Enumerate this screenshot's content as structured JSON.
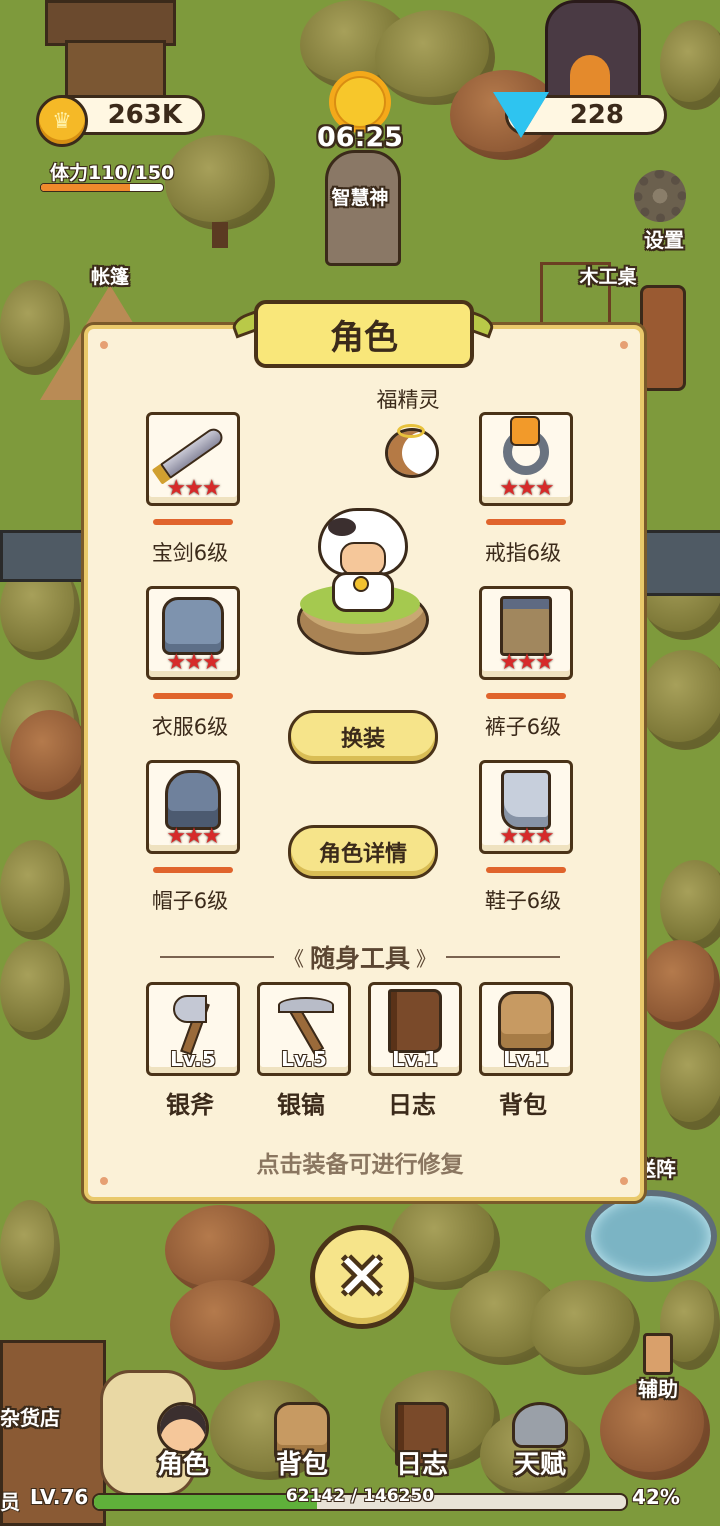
{
  "hud": {
    "coins": "263K",
    "gems": "228",
    "time": "06:25",
    "stamina_label": "体力110/150",
    "stamina_fraction": 0.733
  },
  "map_labels": {
    "god": "智慧神",
    "settings": "设置",
    "tent": "帐篷",
    "workbench": "木工桌",
    "portal": "送阵",
    "assist": "辅助",
    "store": "杂货店"
  },
  "modal": {
    "title": "角色",
    "pet_name": "福精灵",
    "equipment": [
      {
        "label": "宝剑6级",
        "icon": "sword-icon",
        "stars": "★★★"
      },
      {
        "label": "戒指6级",
        "icon": "ring-icon",
        "stars": "★★★"
      },
      {
        "label": "衣服6级",
        "icon": "armor-icon",
        "stars": "★★★"
      },
      {
        "label": "裤子6级",
        "icon": "pants-icon",
        "stars": "★★★"
      },
      {
        "label": "帽子6级",
        "icon": "helmet-icon",
        "stars": "★★★"
      },
      {
        "label": "鞋子6级",
        "icon": "boots-icon",
        "stars": "★★★"
      }
    ],
    "change_outfit": "换装",
    "character_details": "角色详情",
    "tools_header": "随身工具",
    "tools": [
      {
        "label": "银斧",
        "level": "Lv.5",
        "icon": "axe-icon"
      },
      {
        "label": "银镐",
        "level": "Lv.5",
        "icon": "pickaxe-icon"
      },
      {
        "label": "日志",
        "level": "Lv.1",
        "icon": "journal-icon"
      },
      {
        "label": "背包",
        "level": "Lv.1",
        "icon": "backpack-icon"
      }
    ],
    "hint": "点击装备可进行修复"
  },
  "bottom_nav": [
    {
      "label": "角色",
      "icon": "character-icon"
    },
    {
      "label": "背包",
      "icon": "backpack-icon"
    },
    {
      "label": "日志",
      "icon": "journal-icon"
    },
    {
      "label": "天赋",
      "icon": "talent-icon"
    }
  ],
  "xp": {
    "left_label": "员",
    "level": "LV.76",
    "progress": "62142 / 146250",
    "percent": "42%",
    "fraction": 0.42
  },
  "colors": {
    "panel_bg": "#fbf1d7",
    "panel_border": "#e9c96b",
    "star": "#d62a2a",
    "bar": "#e0642c",
    "button": "#f6e48a"
  }
}
